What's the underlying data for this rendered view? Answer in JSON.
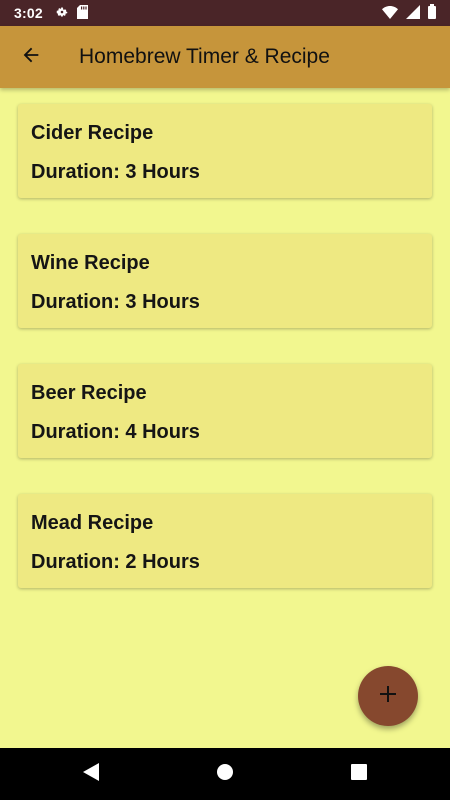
{
  "status_bar": {
    "time": "3:02",
    "icons_left": [
      "gear-icon",
      "sd-card-icon"
    ],
    "icons_right": [
      "wifi-icon",
      "signal-icon",
      "battery-icon"
    ]
  },
  "app_bar": {
    "title": "Homebrew Timer & Recipe",
    "background": "#c6953b",
    "back_icon": "arrow-left-icon"
  },
  "recipes": [
    {
      "title": "Cider Recipe",
      "duration": "Duration: 3 Hours"
    },
    {
      "title": "Wine Recipe",
      "duration": "Duration: 3 Hours"
    },
    {
      "title": "Beer Recipe",
      "duration": "Duration: 4 Hours"
    },
    {
      "title": "Mead Recipe",
      "duration": "Duration: 2 Hours"
    }
  ],
  "fab": {
    "icon": "plus-icon",
    "color": "#86482e"
  },
  "nav_bar": {
    "buttons": [
      "back-triangle-icon",
      "home-circle-icon",
      "recents-square-icon"
    ]
  },
  "colors": {
    "page_background": "#f2f78f",
    "card_background": "#eee982",
    "status_bar": "#4a2528"
  }
}
